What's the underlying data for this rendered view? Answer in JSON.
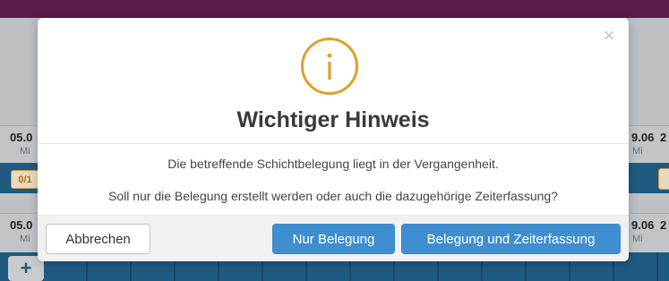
{
  "background": {
    "row1": {
      "date_left": "05.0",
      "day_left": "Mi",
      "date_right": "9.06",
      "date_far_right": "2",
      "day_right": "Mi"
    },
    "badge": "0/1",
    "row2": {
      "date_left": "05.0",
      "day_left": "Mi",
      "date_right": "9.06",
      "date_far_right": "2",
      "day_right": "Mi"
    },
    "plus": "+"
  },
  "dialog": {
    "title": "Wichtiger Hinweis",
    "icon": "info-icon",
    "close_symbol": "×",
    "message_line1": "Die betreffende Schichtbelegung liegt in der Vergangenheit.",
    "message_line2": "Soll nur die Belegung erstellt werden oder auch die dazugehörige Zeiterfassung?",
    "buttons": {
      "cancel": "Abbrechen",
      "only_assignment": "Nur Belegung",
      "assignment_and_time": "Belegung und Zeiterfassung"
    }
  },
  "colors": {
    "topbar": "#5b1b48",
    "icon_accent": "#dca12e",
    "primary_button": "#3f8fd0"
  }
}
